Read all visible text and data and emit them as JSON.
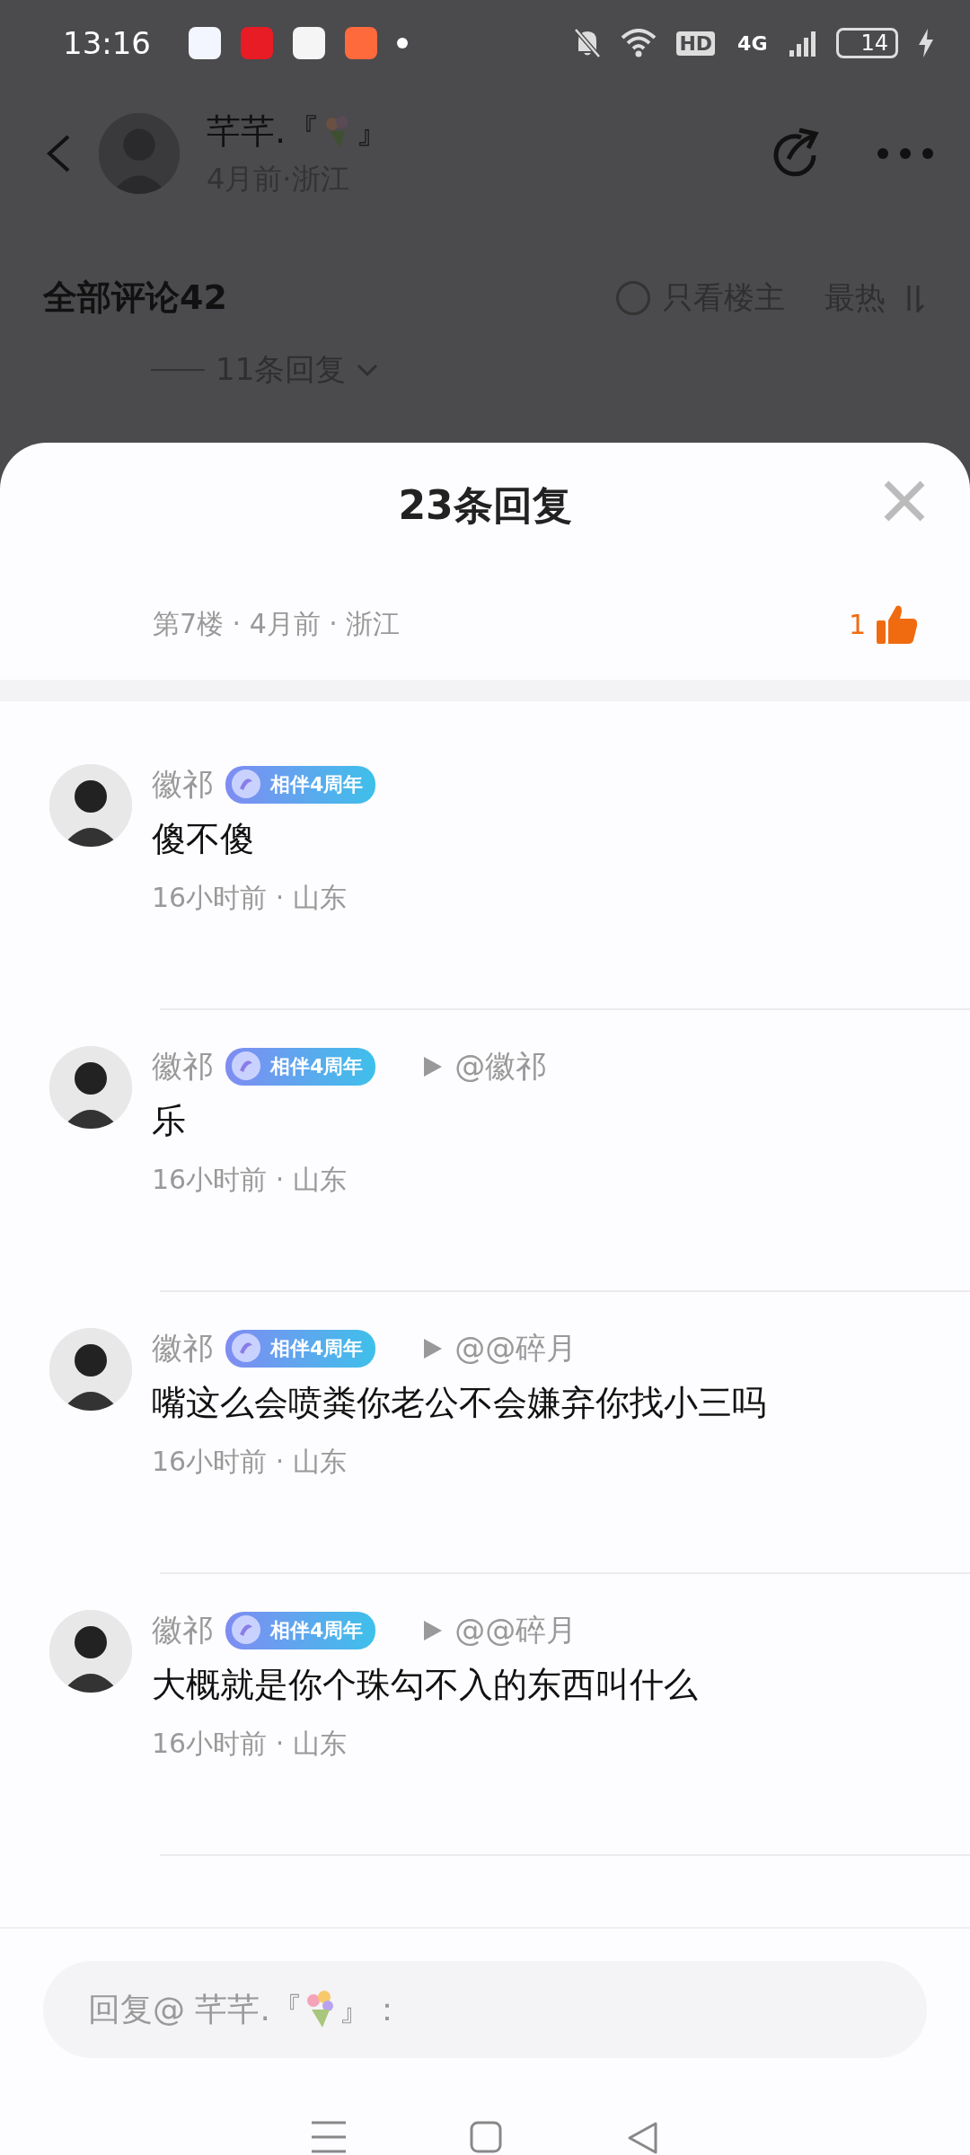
{
  "status_bar": {
    "time": "13:16",
    "network": "HD",
    "cell": "4G",
    "battery": "14"
  },
  "post_header": {
    "author_prefix": "芊芊.『",
    "author_suffix": "』",
    "meta": "4月前·浙江"
  },
  "comments_bar": {
    "title": "全部评论42",
    "only_op": {
      "label": "只看楼主",
      "checked": false
    },
    "sort": "最热",
    "replies_link": "11条回复"
  },
  "sheet": {
    "title": "23条回复",
    "floor_meta": "第7楼 · 4月前 · 浙江",
    "likes": "1"
  },
  "replies": [
    {
      "name": "徽祁",
      "badge": "相伴4周年",
      "text": "傻不傻",
      "time": "16小时前 · 山东"
    },
    {
      "name": "徽祁",
      "badge": "相伴4周年",
      "reply_to": "@徽祁",
      "text": "乐",
      "time": "16小时前 · 山东"
    },
    {
      "name": "徽祁",
      "badge": "相伴4周年",
      "reply_to": "@@碎月",
      "text": "嘴这么会喷粪你老公不会嫌弃你找小三吗",
      "time": "16小时前 · 山东"
    },
    {
      "name": "徽祁",
      "badge": "相伴4周年",
      "reply_to": "@@碎月",
      "text": "大概就是你个珠勾不入的东西叫什么",
      "time": "16小时前 · 山东"
    }
  ],
  "reply_box": {
    "placeholder_prefix": "回复@ 芊芊.『",
    "placeholder_suffix": "』："
  }
}
